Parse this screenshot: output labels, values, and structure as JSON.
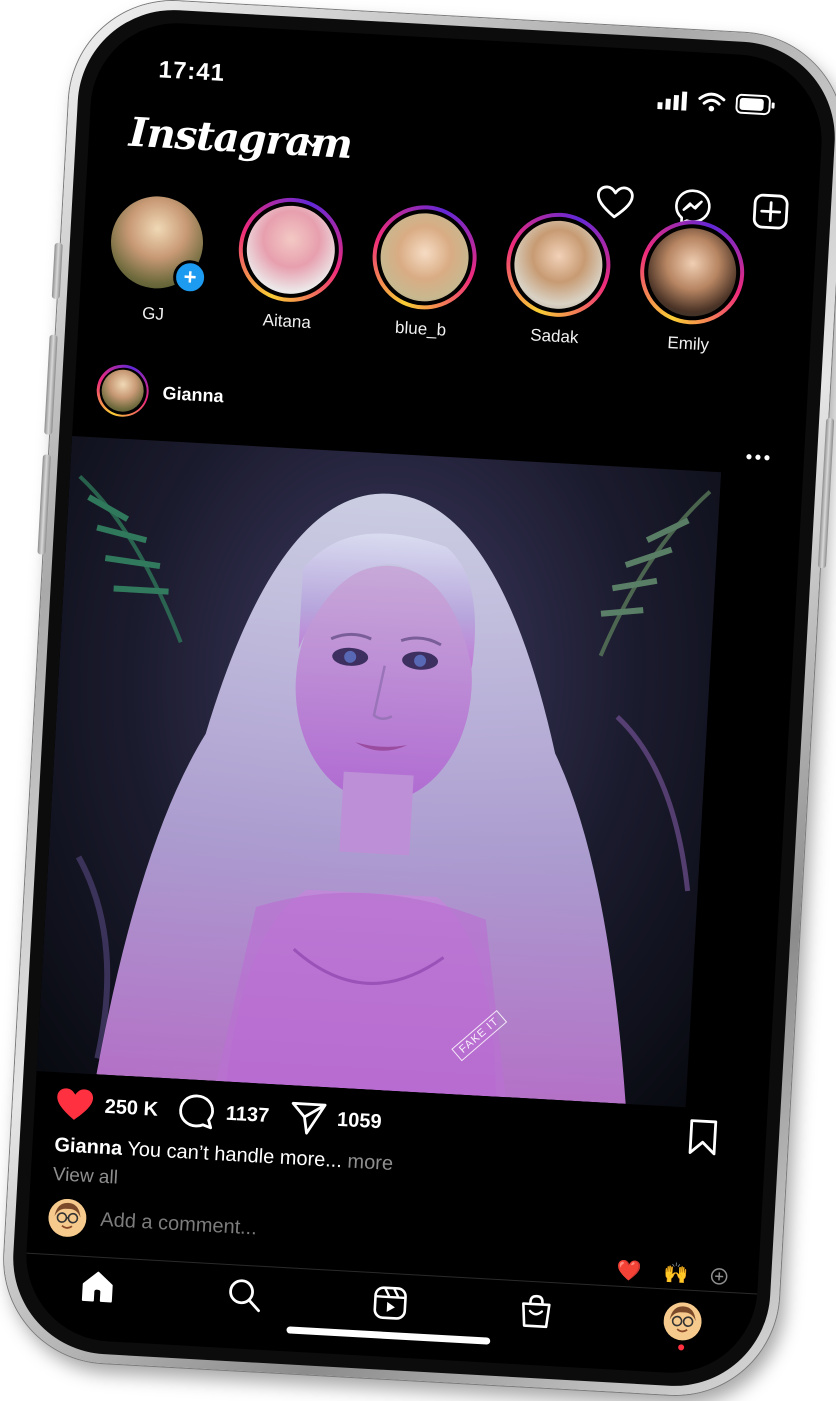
{
  "status_bar": {
    "time": "17:41"
  },
  "header": {
    "logo_text": "Instagram"
  },
  "stories": [
    {
      "name": "GJ",
      "own": true
    },
    {
      "name": "Aitana",
      "own": false
    },
    {
      "name": "blue_b",
      "own": false
    },
    {
      "name": "Sadak",
      "own": false
    },
    {
      "name": "Emily",
      "own": false
    }
  ],
  "post": {
    "username": "Gianna",
    "watermark": "FAKE IT",
    "likes": "250 K",
    "comments": "1137",
    "shares": "1059",
    "caption_user": "Gianna",
    "caption_text": " You can’t handle more...",
    "caption_more": " more",
    "view_all": "View all"
  },
  "comment_box": {
    "placeholder": "Add a comment..."
  },
  "quick_reactions": [
    "❤️",
    "🙌"
  ],
  "colors": {
    "like_red": "#ff3040",
    "story_ring": [
      "#f9ce34",
      "#ee2a7b",
      "#6228d7"
    ],
    "badge_blue": "#1d9bf0"
  },
  "nav": [
    "home-icon",
    "search-icon",
    "reels-icon",
    "shop-icon",
    "profile-avatar"
  ]
}
